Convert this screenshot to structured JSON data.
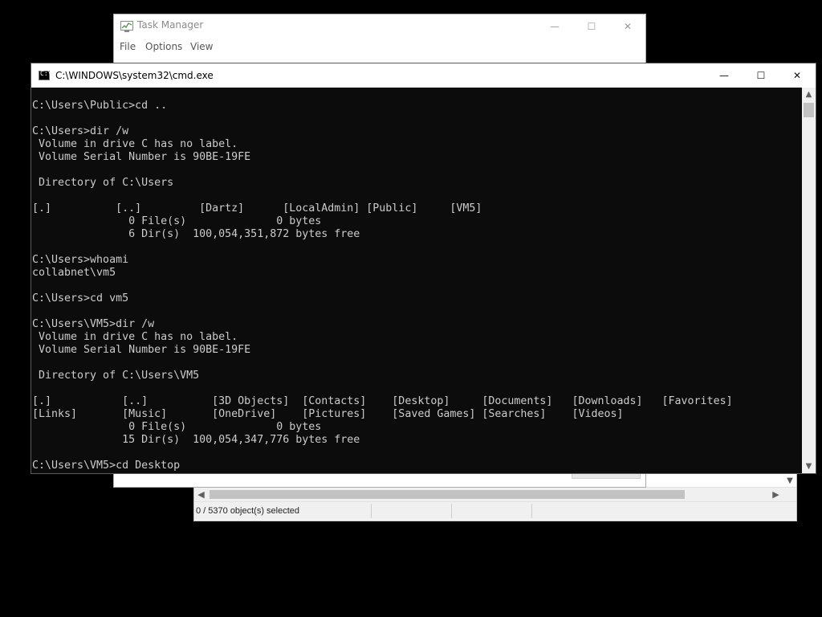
{
  "task_manager": {
    "title": "Task Manager",
    "menus": [
      "File",
      "Options",
      "View"
    ],
    "status_text": "0 / 5370 object(s) selected",
    "window_controls": {
      "minimize": "—",
      "maximize": "☐",
      "close": "✕"
    }
  },
  "cmd": {
    "title": "C:\\WINDOWS\\system32\\cmd.exe",
    "window_controls": {
      "minimize": "—",
      "maximize": "☐",
      "close": "✕"
    },
    "console_lines": [
      "C:\\Users\\Public>cd ..",
      "",
      "C:\\Users>dir /w",
      " Volume in drive C has no label.",
      " Volume Serial Number is 90BE-19FE",
      "",
      " Directory of C:\\Users",
      "",
      "[.]          [..]         [Dartz]      [LocalAdmin] [Public]     [VM5]",
      "               0 File(s)              0 bytes",
      "               6 Dir(s)  100,054,351,872 bytes free",
      "",
      "C:\\Users>whoami",
      "collabnet\\vm5",
      "",
      "C:\\Users>cd vm5",
      "",
      "C:\\Users\\VM5>dir /w",
      " Volume in drive C has no label.",
      " Volume Serial Number is 90BE-19FE",
      "",
      " Directory of C:\\Users\\VM5",
      "",
      "[.]           [..]          [3D Objects]  [Contacts]    [Desktop]     [Documents]   [Downloads]   [Favorites]",
      "[Links]       [Music]       [OneDrive]    [Pictures]    [Saved Games] [Searches]    [Videos]",
      "               0 File(s)              0 bytes",
      "              15 Dir(s)  100,054,347,776 bytes free",
      "",
      "C:\\Users\\VM5>cd Desktop"
    ]
  },
  "colors": {
    "console_bg": "#0c0c0c",
    "console_fg": "#cccccc",
    "titlebar_bg": "#ffffff",
    "desktop_bg": "#000000"
  },
  "icons": {
    "task_manager": "task-manager-icon",
    "cmd": "command-prompt-icon"
  }
}
